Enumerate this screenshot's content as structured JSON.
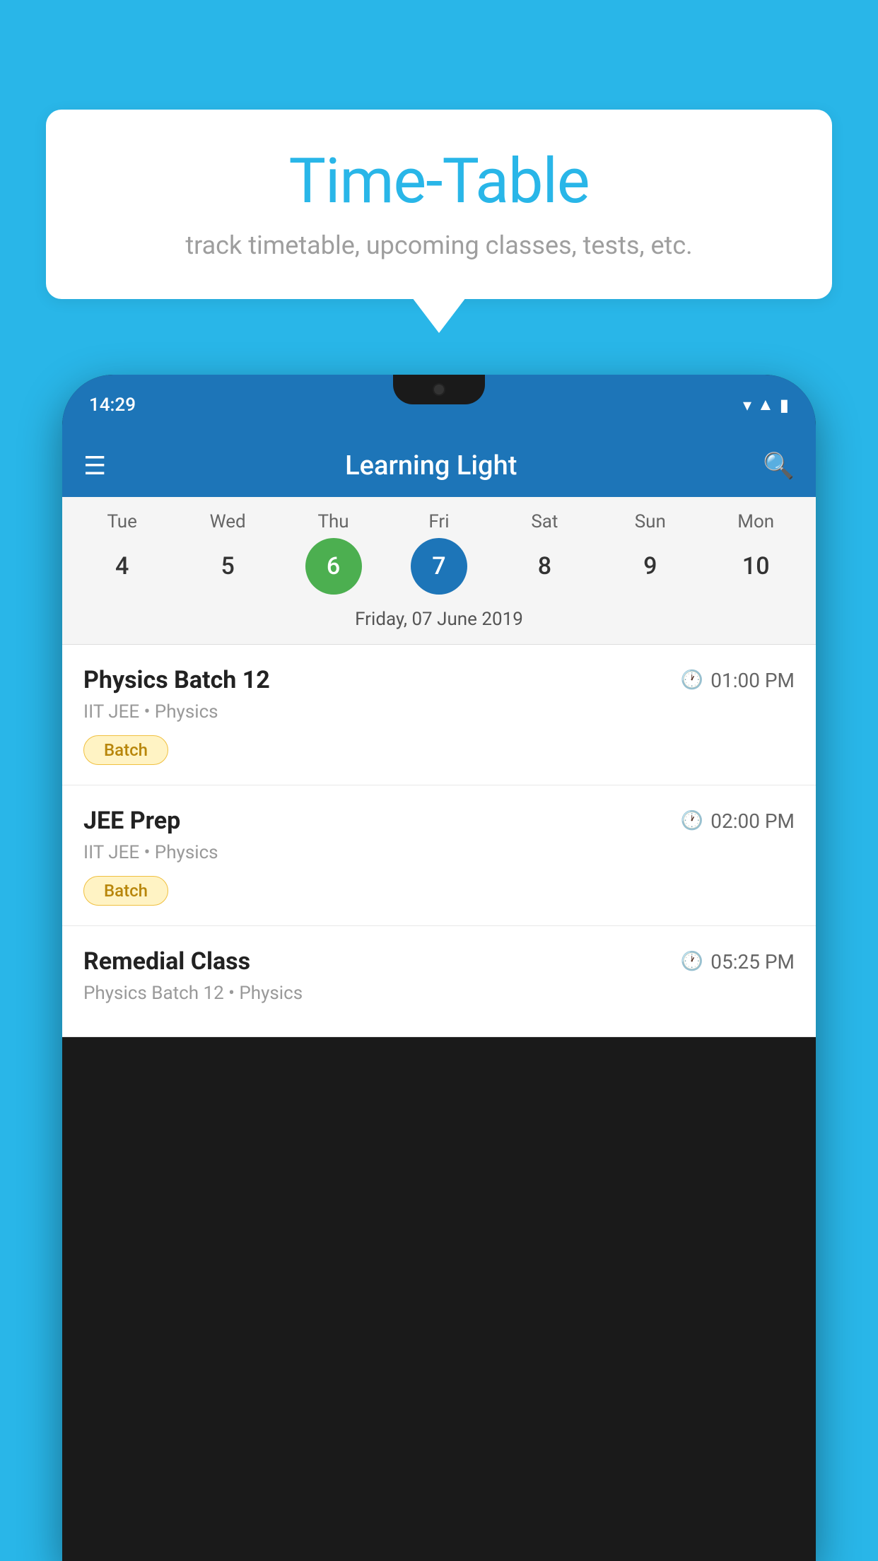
{
  "background_color": "#29B6E8",
  "speech_bubble": {
    "title": "Time-Table",
    "subtitle": "track timetable, upcoming classes, tests, etc."
  },
  "phone": {
    "status_bar": {
      "time": "14:29",
      "wifi_icon": "wifi",
      "signal_icon": "signal",
      "battery_icon": "battery"
    },
    "app_bar": {
      "title": "Learning Light",
      "menu_icon": "hamburger",
      "search_icon": "search"
    },
    "calendar": {
      "days": [
        {
          "label": "Tue",
          "number": "4"
        },
        {
          "label": "Wed",
          "number": "5"
        },
        {
          "label": "Thu",
          "number": "6",
          "state": "today"
        },
        {
          "label": "Fri",
          "number": "7",
          "state": "selected"
        },
        {
          "label": "Sat",
          "number": "8"
        },
        {
          "label": "Sun",
          "number": "9"
        },
        {
          "label": "Mon",
          "number": "10"
        }
      ],
      "selected_date_label": "Friday, 07 June 2019"
    },
    "schedule": {
      "items": [
        {
          "title": "Physics Batch 12",
          "time": "01:00 PM",
          "subtitle": "IIT JEE • Physics",
          "tag": "Batch"
        },
        {
          "title": "JEE Prep",
          "time": "02:00 PM",
          "subtitle": "IIT JEE • Physics",
          "tag": "Batch"
        },
        {
          "title": "Remedial Class",
          "time": "05:25 PM",
          "subtitle": "Physics Batch 12 • Physics",
          "tag": null
        }
      ]
    }
  }
}
